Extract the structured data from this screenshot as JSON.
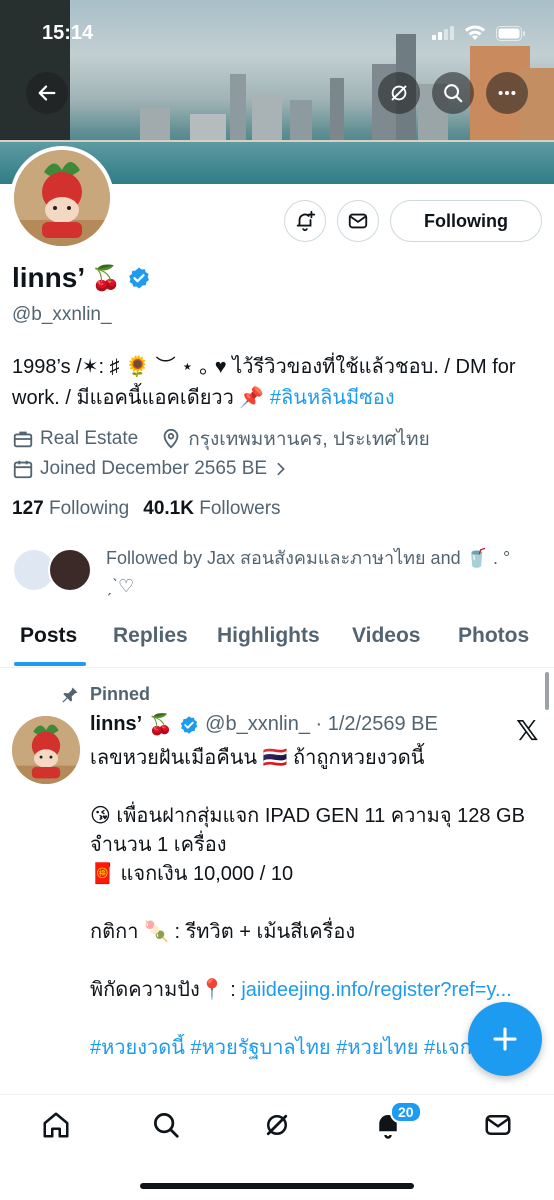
{
  "status_bar": {
    "time": "15:14"
  },
  "profile": {
    "display_name": "linns’",
    "name_emoji": "🍒",
    "handle": "@b_xxnlin_",
    "bio_text": "1998’s /✶: ♯ 🌻 ︶ ⋆ ｡ ♥ ไว้รีวิวของที่ใช้แล้วชอบ. / DM for work. / มีแอคนี้แอคเดียวว 📌 ",
    "bio_hashtag": "#ลินหลินมีซอง",
    "category": "Real Estate",
    "location": "กรุงเทพมหานคร, ประเทศไทย",
    "joined": "Joined December 2565 BE",
    "following_count": "127",
    "following_label": "Following",
    "followers_count": "40.1K",
    "followers_label": "Followers",
    "followed_by": "Followed by Jax สอนสังคมและภาษาไทย and 🥤 . ° ˏˋ♡"
  },
  "actions": {
    "follow_state": "Following"
  },
  "tabs": [
    "Posts",
    "Replies",
    "Highlights",
    "Videos",
    "Photos"
  ],
  "pinned_post": {
    "pinned_label": "Pinned",
    "author": "linns’",
    "author_emoji": "🍒",
    "handle_date": "@b_xxnlin_ · 1/2/2569 BE",
    "line1": "เลขหวยฝันเมือคืนน 🇹🇭 ถ้าถูกหวยงวดนี้",
    "line2": "😘 เพื่อนฝากสุ่มแจก IPAD GEN 11 ความจุ 128 GB จำนวน 1 เครื่อง",
    "line3": "🧧 แจกเงิน 10,000 / 10",
    "line4": "กติกา 🍡 : รีทวิต + เม้นสีเครื่อง",
    "line5_prefix": "พิกัดความปัง📍 : ",
    "line5_link": "jaiideejing.info/register?ref=y...",
    "hashtags": "#หวยงวดนี้ #หวยรัฐบาลไทย #หวยไทย #แจก"
  },
  "bottom_nav": {
    "notification_count": "20"
  },
  "colors": {
    "accent": "#1d9bf0",
    "text": "#0f1419",
    "muted": "#536471"
  }
}
